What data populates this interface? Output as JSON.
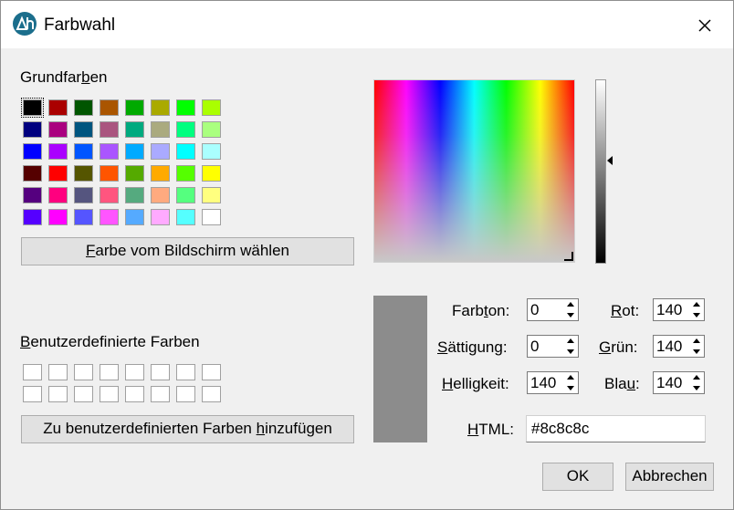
{
  "window": {
    "title": "Farbwahl",
    "app_icon": "app-logo-icon",
    "close_icon": "close-icon"
  },
  "basic": {
    "label_pre": "Grundfar",
    "label_u": "b",
    "label_post": "en",
    "swatches": [
      [
        "#000000",
        "#aa0000",
        "#005500",
        "#aa5500",
        "#00aa00",
        "#aaaa00",
        "#00ff00",
        "#aaff00"
      ],
      [
        "#00007f",
        "#aa007f",
        "#00557f",
        "#aa557f",
        "#00aa7f",
        "#aaaa7f",
        "#00ff7f",
        "#aaff7f"
      ],
      [
        "#0000ff",
        "#aa00ff",
        "#0055ff",
        "#aa55ff",
        "#00aaff",
        "#aaaaff",
        "#00ffff",
        "#aaffff"
      ],
      [
        "#550000",
        "#ff0000",
        "#555500",
        "#ff5500",
        "#55aa00",
        "#ffaa00",
        "#55ff00",
        "#ffff00"
      ],
      [
        "#55007f",
        "#ff007f",
        "#55557f",
        "#ff557f",
        "#55aa7f",
        "#ffaa7f",
        "#55ff7f",
        "#ffff7f"
      ],
      [
        "#5500ff",
        "#ff00ff",
        "#5555ff",
        "#ff55ff",
        "#55aaff",
        "#ffaaff",
        "#55ffff",
        "#ffffff"
      ]
    ]
  },
  "pick_screen_button": {
    "u": "F",
    "rest": "arbe vom Bildschirm wählen"
  },
  "custom": {
    "label_u": "B",
    "label_rest": "enutzerdefinierte Farben",
    "rows": 2,
    "cols": 8
  },
  "add_custom_button": {
    "pre": "Zu benutzerdefinierten Farben ",
    "u": "h",
    "post": "inzufügen"
  },
  "current_color": "#8c8c8c",
  "fields": {
    "hue": {
      "pre": "Farb",
      "u": "t",
      "post": "on:",
      "value": "0"
    },
    "sat": {
      "pre": "",
      "u": "S",
      "post": "ättigung:",
      "value": "0"
    },
    "val": {
      "pre": "",
      "u": "H",
      "post": "elligkeit:",
      "value": "140"
    },
    "red": {
      "pre": "",
      "u": "R",
      "post": "ot:",
      "value": "140"
    },
    "green": {
      "pre": "",
      "u": "G",
      "post": "rün:",
      "value": "140"
    },
    "blue": {
      "pre": "Bla",
      "u": "u",
      "post": ":",
      "value": "140"
    },
    "html": {
      "pre": "",
      "u": "H",
      "post": "TML:",
      "value": "#8c8c8c"
    }
  },
  "buttons": {
    "ok": "OK",
    "cancel": "Abbrechen"
  }
}
